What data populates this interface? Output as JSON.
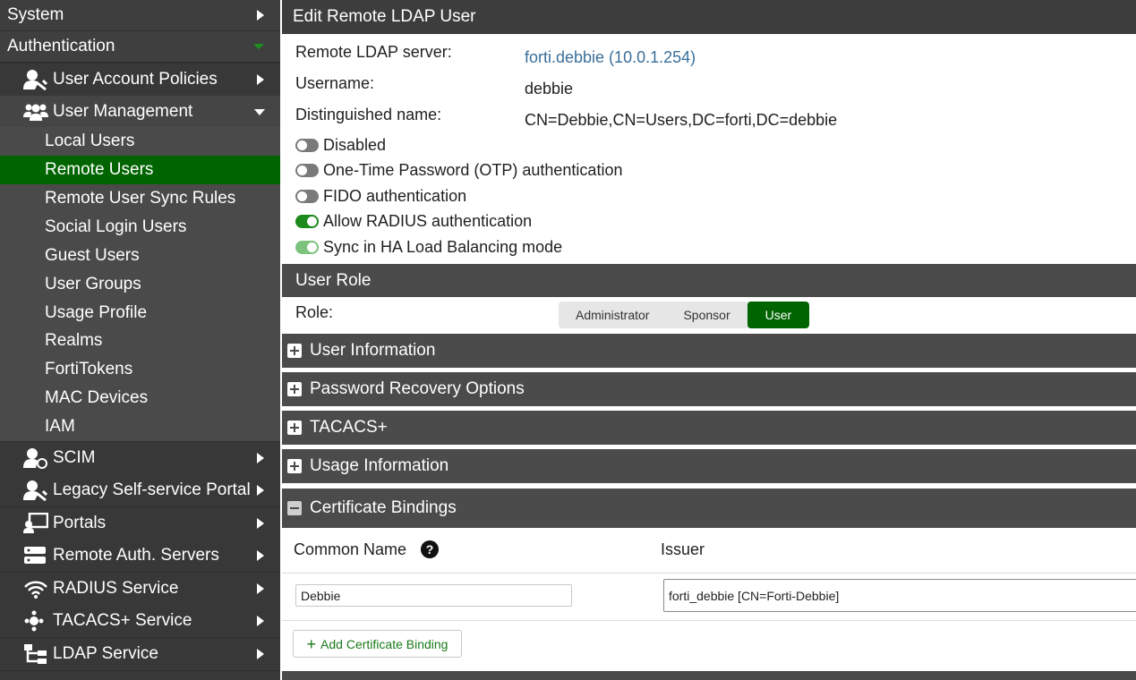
{
  "sidebar": {
    "system": "System",
    "authentication": "Authentication",
    "user_account_policies": "User Account Policies",
    "user_management": "User Management",
    "sub_items": [
      "Local Users",
      "Remote Users",
      "Remote User Sync Rules",
      "Social Login Users",
      "Guest Users",
      "User Groups",
      "Usage Profile",
      "Realms",
      "FortiTokens",
      "MAC Devices",
      "IAM"
    ],
    "scim": "SCIM",
    "legacy_portal": "Legacy Self-service Portal",
    "portals": "Portals",
    "remote_auth_servers": "Remote Auth. Servers",
    "radius_service": "RADIUS Service",
    "tacacs_service": "TACACS+ Service",
    "ldap_service": "LDAP Service"
  },
  "page": {
    "title": "Edit Remote LDAP User",
    "remote_ldap_server_label": "Remote LDAP server:",
    "remote_ldap_server_value": "forti.debbie (10.0.1.254)",
    "username_label": "Username:",
    "username_value": "debbie",
    "dn_label": "Distinguished name:",
    "dn_value": "CN=Debbie,CN=Users,DC=forti,DC=debbie",
    "toggles": [
      {
        "label": "Disabled",
        "on": false
      },
      {
        "label": "One-Time Password (OTP) authentication",
        "on": false
      },
      {
        "label": "FIDO authentication",
        "on": false
      },
      {
        "label": "Allow RADIUS authentication",
        "on": true
      },
      {
        "label": "Sync in HA Load Balancing mode",
        "on": true
      }
    ],
    "user_role_header": "User Role",
    "role_label": "Role:",
    "role_options": [
      "Administrator",
      "Sponsor",
      "User"
    ],
    "role_selected": "User",
    "sections": {
      "user_information": "User Information",
      "password_recovery": "Password Recovery Options",
      "tacacs": "TACACS+",
      "usage_information": "Usage Information",
      "certificate_bindings": "Certificate Bindings"
    },
    "cert_table": {
      "headers": [
        "Common Name",
        "Issuer"
      ],
      "help": "?",
      "row": {
        "common_name": "Debbie",
        "issuer": "forti_debbie [CN=Forti-Debbie]"
      }
    },
    "add_binding_label": "Add Certificate Binding",
    "add_binding_icon": "+"
  },
  "colors": {
    "active_green": "#006400",
    "toggle_on": "#1c8a1c",
    "link": "#3a6f9a",
    "sidebar_bg": "#2f2f2f"
  }
}
